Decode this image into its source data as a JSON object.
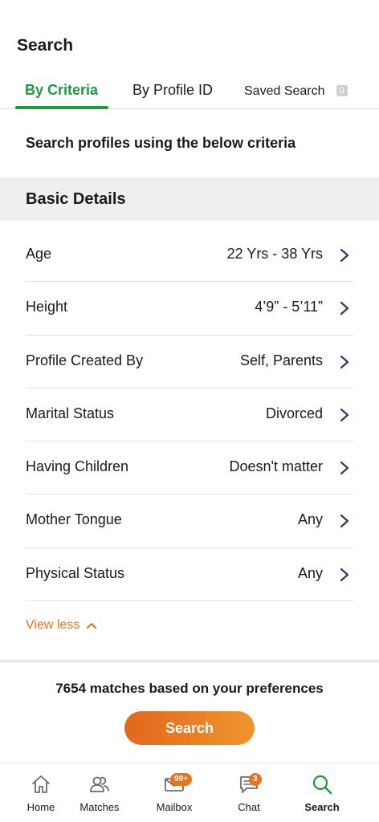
{
  "header": {
    "title": "Search"
  },
  "tabs": [
    {
      "label": "By Criteria",
      "active": true
    },
    {
      "label": "By Profile ID",
      "active": false
    },
    {
      "label": "Saved Search",
      "count": "0",
      "active": false
    }
  ],
  "main": {
    "subtitle": "Search profiles using the below criteria",
    "section_title": "Basic Details",
    "criteria": [
      {
        "label": "Age",
        "value": "22 Yrs - 38 Yrs"
      },
      {
        "label": "Height",
        "value": "4’9” - 5’11”"
      },
      {
        "label": "Profile Created By",
        "value": "Self, Parents"
      },
      {
        "label": "Marital Status",
        "value": "Divorced"
      },
      {
        "label": "Having Children",
        "value": "Doesn't matter"
      },
      {
        "label": "Mother Tongue",
        "value": "Any"
      },
      {
        "label": "Physical Status",
        "value": "Any"
      }
    ],
    "view_less_label": "View less"
  },
  "footer": {
    "matches_text": "7654 matches based on your preferences",
    "search_button_label": "Search"
  },
  "bottom_nav": [
    {
      "label": "Home",
      "icon": "home-icon"
    },
    {
      "label": "Matches",
      "icon": "users-icon"
    },
    {
      "label": "Mailbox",
      "icon": "mail-icon",
      "badge": "99+"
    },
    {
      "label": "Chat",
      "icon": "chat-icon",
      "badge": "3"
    },
    {
      "label": "Search",
      "icon": "search-icon",
      "active": true
    }
  ],
  "colors": {
    "accent_green": "#1f9a3a",
    "accent_orange": "#e8731c",
    "chevron": "#2a3a6e"
  }
}
